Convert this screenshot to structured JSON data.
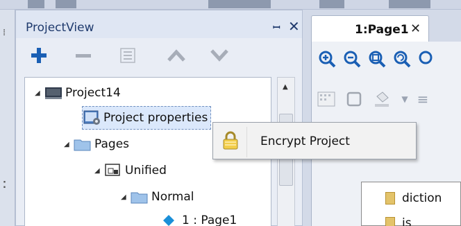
{
  "project_view": {
    "title": "ProjectView",
    "pin_glyph": "ᵃ",
    "close_glyph": "✕",
    "toolbar": [
      {
        "name": "add",
        "icon": "plus-icon"
      },
      {
        "name": "remove",
        "icon": "minus-icon"
      },
      {
        "name": "rename",
        "icon": "rename-icon"
      },
      {
        "name": "move-up",
        "icon": "chevron-up-icon"
      },
      {
        "name": "move-down",
        "icon": "chevron-down-icon"
      }
    ],
    "tree": [
      {
        "label": "Project14",
        "icon": "computer-icon",
        "expanded": true
      },
      {
        "label": "Project properties",
        "icon": "properties-icon",
        "selected": true
      },
      {
        "label": "Pages",
        "icon": "folder-icon",
        "expanded": true
      },
      {
        "label": "Unified",
        "icon": "unified-pages-icon",
        "expanded": true
      },
      {
        "label": "Normal",
        "icon": "folder-icon",
        "expanded": true
      },
      {
        "label": "1 : Page1",
        "icon": "page-icon"
      }
    ]
  },
  "context_menu": {
    "items": [
      {
        "label": "Encrypt Project",
        "icon": "lock-icon"
      }
    ]
  },
  "document": {
    "tab_label": "1:Page1",
    "tab_close": "✕",
    "zoom_tools": [
      "zoom-in-icon",
      "zoom-out-icon",
      "zoom-fit-icon",
      "zoom-refresh-icon"
    ],
    "files": [
      "diction",
      "js"
    ]
  },
  "colors": {
    "accent_blue": "#1a5fb4",
    "pane_bg": "#e9edf5",
    "menu_bg": "#f2f2f2"
  }
}
